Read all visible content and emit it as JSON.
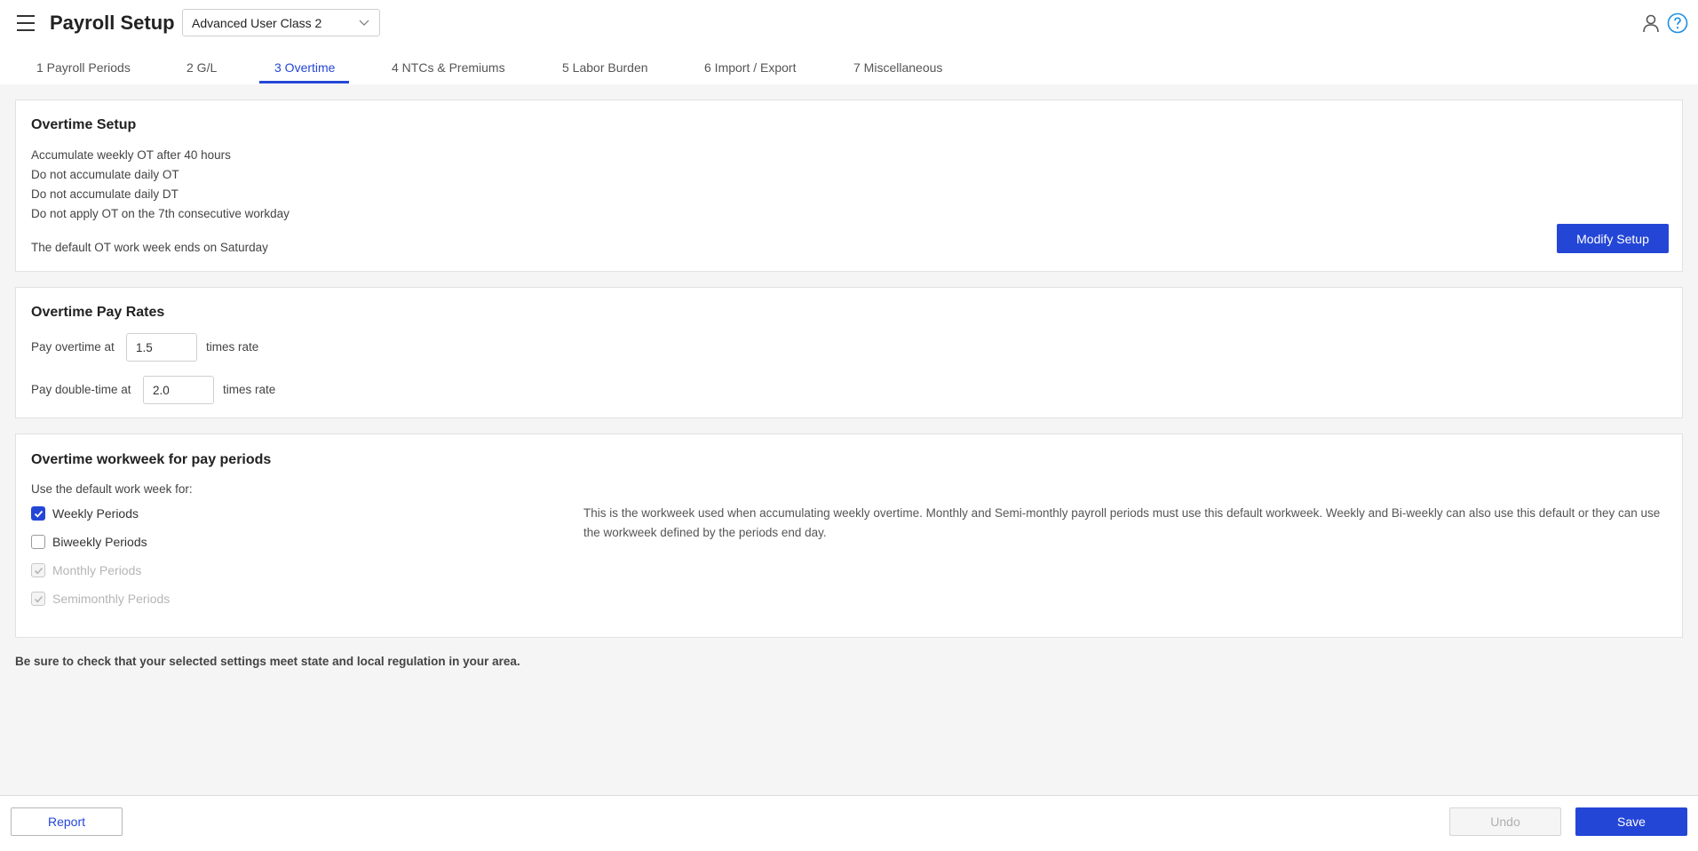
{
  "header": {
    "title": "Payroll Setup",
    "class_select": {
      "value": "Advanced User Class 2"
    }
  },
  "tabs": [
    {
      "label": "1 Payroll Periods"
    },
    {
      "label": "2 G/L"
    },
    {
      "label": "3 Overtime",
      "active": true
    },
    {
      "label": "4 NTCs & Premiums"
    },
    {
      "label": "5 Labor Burden"
    },
    {
      "label": "6 Import / Export"
    },
    {
      "label": "7 Miscellaneous"
    }
  ],
  "overtime_setup": {
    "title": "Overtime Setup",
    "lines": [
      "Accumulate weekly OT after 40 hours",
      "Do not accumulate daily OT",
      "Do not accumulate daily DT",
      "Do not apply OT on the 7th consecutive workday"
    ],
    "week_end": "The default OT work week ends on Saturday",
    "modify_button": "Modify Setup"
  },
  "pay_rates": {
    "title": "Overtime Pay Rates",
    "overtime_label": "Pay overtime at",
    "overtime_value": "1.5",
    "doubletime_label": "Pay double-time at",
    "doubletime_value": "2.0",
    "suffix": "times rate"
  },
  "workweek": {
    "title": "Overtime workweek for pay periods",
    "intro": "Use the default work week for:",
    "options": [
      {
        "label": "Weekly Periods",
        "checked": true,
        "disabled": false
      },
      {
        "label": "Biweekly Periods",
        "checked": false,
        "disabled": false
      },
      {
        "label": "Monthly Periods",
        "checked": true,
        "disabled": true
      },
      {
        "label": "Semimonthly Periods",
        "checked": true,
        "disabled": true
      }
    ],
    "description": "This is the workweek used when accumulating weekly overtime. Monthly and Semi-monthly payroll periods must use this default workweek. Weekly and Bi-weekly can also use this default or they can use the workweek defined by the periods end day."
  },
  "warning": "Be sure to check that your selected settings meet state and local regulation in your area.",
  "footer": {
    "report_button": "Report",
    "undo_button": "Undo",
    "save_button": "Save"
  },
  "colors": {
    "accent": "#2446d6",
    "background": "#f5f5f5"
  }
}
